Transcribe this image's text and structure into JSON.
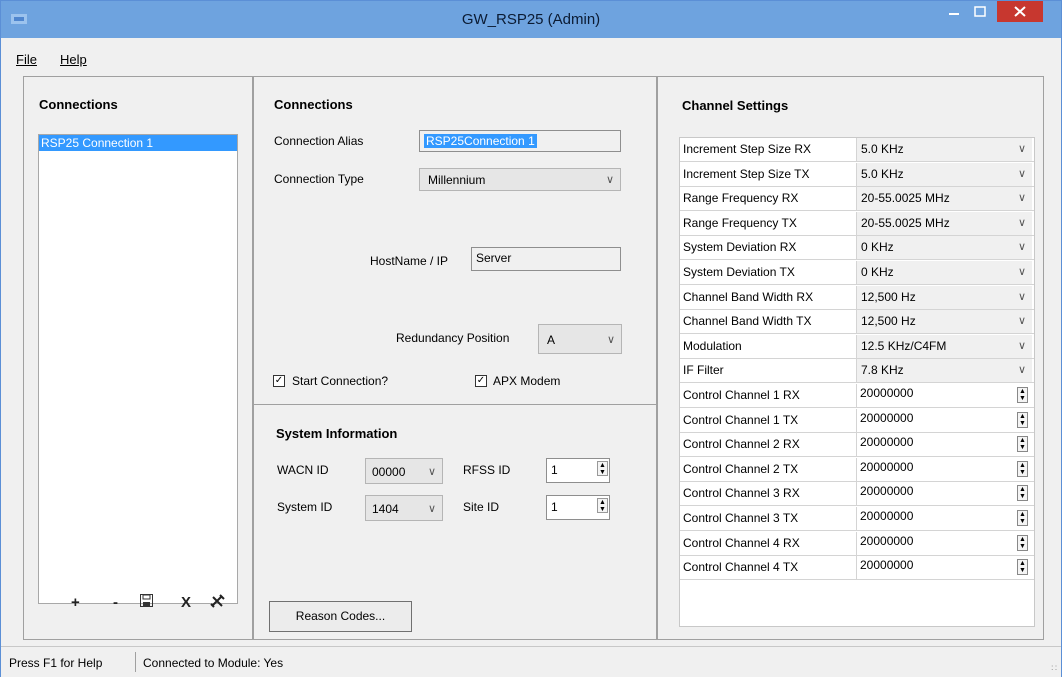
{
  "window": {
    "title": "GW_RSP25 (Admin)",
    "icon": "app-icon"
  },
  "menu": {
    "file": "File",
    "help": "Help"
  },
  "left": {
    "heading": "Connections",
    "items": [
      "RSP25 Connection 1"
    ],
    "toolbar": {
      "add": "+",
      "remove": "-",
      "save": "save-icon",
      "delete": "X",
      "tools": "tools-icon"
    }
  },
  "connection": {
    "heading": "Connections",
    "alias_label": "Connection Alias",
    "alias_value": "RSP25Connection 1",
    "type_label": "Connection Type",
    "type_value": "Millennium",
    "host_label": "HostName / IP",
    "host_value": "Server",
    "redundancy_label": "Redundancy Position",
    "redundancy_value": "A",
    "start_connection_label": "Start Connection?",
    "apx_modem_label": "APX Modem"
  },
  "system": {
    "heading": "System Information",
    "wacn_label": "WACN ID",
    "wacn_value": "00000",
    "rfss_label": "RFSS ID",
    "rfss_value": "1",
    "system_label": "System ID",
    "system_value": "1404",
    "site_label": "Site ID",
    "site_value": "1",
    "reason_codes_label": "Reason Codes..."
  },
  "channel": {
    "heading": "Channel Settings",
    "rows": [
      {
        "name": "Increment Step Size RX",
        "value": "5.0 KHz"
      },
      {
        "name": "Increment Step Size TX",
        "value": "5.0 KHz"
      },
      {
        "name": "Range Frequency RX",
        "value": "20-55.0025 MHz"
      },
      {
        "name": "Range Frequency TX",
        "value": "20-55.0025 MHz"
      },
      {
        "name": "System Deviation RX",
        "value": "0 KHz"
      },
      {
        "name": "System Deviation TX",
        "value": "0 KHz"
      },
      {
        "name": "Channel Band Width RX",
        "value": "12,500 Hz"
      },
      {
        "name": "Channel Band Width TX",
        "value": "12,500 Hz"
      },
      {
        "name": "Modulation",
        "value": "12.5 KHz/C4FM"
      },
      {
        "name": "IF Filter",
        "value": "7.8 KHz"
      },
      {
        "name": "Control Channel 1 RX",
        "value": "20000000"
      },
      {
        "name": "Control Channel 1 TX",
        "value": "20000000"
      },
      {
        "name": "Control Channel 2 RX",
        "value": "20000000"
      },
      {
        "name": "Control Channel 2 TX",
        "value": "20000000"
      },
      {
        "name": "Control Channel 3 RX",
        "value": "20000000"
      },
      {
        "name": "Control Channel 3 TX",
        "value": "20000000"
      },
      {
        "name": "Control Channel 4 RX",
        "value": "20000000"
      },
      {
        "name": "Control Channel 4 TX",
        "value": "20000000"
      }
    ]
  },
  "status": {
    "help": "Press F1 for Help",
    "connected": "Connected to Module: Yes"
  }
}
